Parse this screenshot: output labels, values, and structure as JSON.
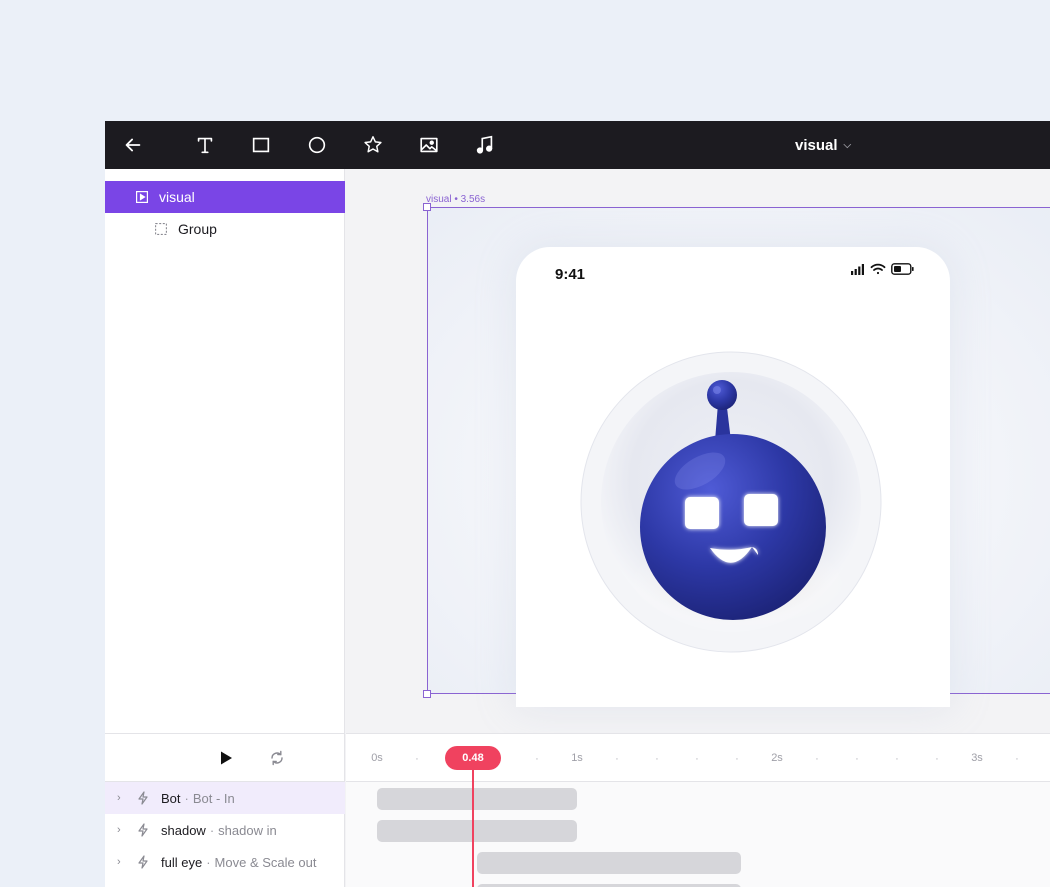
{
  "toolbar": {
    "tools": [
      "back",
      "text",
      "rectangle",
      "ellipse",
      "star",
      "image",
      "audio"
    ],
    "doc_title": "visual"
  },
  "layers": [
    {
      "label": "visual",
      "selected": true,
      "icon": "play-frame-icon"
    },
    {
      "label": "Group",
      "selected": false,
      "icon": "group-dashed-icon"
    }
  ],
  "canvas": {
    "frame_label": "visual • 3.56s",
    "phone_time": "9:41"
  },
  "timeline": {
    "playhead_value": "0.48",
    "ticks": [
      "0s",
      "1s",
      "2s",
      "3s"
    ],
    "tracks": [
      {
        "name": "Bot",
        "animation": "Bot - In"
      },
      {
        "name": "shadow",
        "animation": "shadow in"
      },
      {
        "name": "full eye",
        "animation": "Move & Scale out"
      }
    ]
  },
  "colors": {
    "accent": "#7a45e6",
    "playhead": "#f0425f",
    "toolbar_bg": "#1c1b20",
    "bot_blue": "#2f3ba8"
  }
}
